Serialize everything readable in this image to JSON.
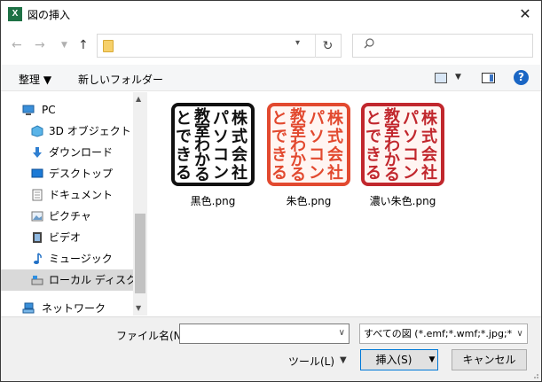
{
  "window": {
    "app_icon_letter": "X",
    "title": "図の挿入",
    "close_glyph": "✕"
  },
  "address": {
    "path": "",
    "search_placeholder": ""
  },
  "toolbar": {
    "organize_label": "整理 ▼",
    "new_folder_label": "新しいフォルダー"
  },
  "sidebar": {
    "items": [
      {
        "label": "PC",
        "icon": "pc-icon"
      },
      {
        "label": "3D オブジェクト",
        "icon": "3d-objects-icon"
      },
      {
        "label": "ダウンロード",
        "icon": "download-icon"
      },
      {
        "label": "デスクトップ",
        "icon": "desktop-icon"
      },
      {
        "label": "ドキュメント",
        "icon": "document-icon"
      },
      {
        "label": "ピクチャ",
        "icon": "pictures-icon"
      },
      {
        "label": "ビデオ",
        "icon": "video-icon"
      },
      {
        "label": "ミュージック",
        "icon": "music-icon"
      },
      {
        "label": "ローカル ディスク (C:)",
        "icon": "local-disk-icon",
        "selected": true
      },
      {
        "label": "ネットワーク",
        "icon": "network-icon"
      }
    ]
  },
  "files": [
    {
      "name": "黒色.png",
      "color": "#111111",
      "stamp_text": [
        "株",
        "式",
        "会",
        "社",
        "パ",
        "ソ",
        "コ",
        "ン",
        "教",
        "室",
        "わ",
        "か",
        "る",
        "と",
        "で",
        "き",
        "る"
      ]
    },
    {
      "name": "朱色.png",
      "color": "#e2492f"
    },
    {
      "name": "濃い朱色.png",
      "color": "#c1272d"
    }
  ],
  "stamp_lines": [
    "株式会社",
    "パソコン",
    "教室わかる",
    "とできる"
  ],
  "bottom": {
    "filename_label": "ファイル名(N):",
    "filename_value": "",
    "filetype_value": "すべての図 (*.emf;*.wmf;*.jpg;*.j",
    "tools_label": "ツール(L)",
    "insert_label": "挿入(S)",
    "cancel_label": "キャンセル"
  }
}
